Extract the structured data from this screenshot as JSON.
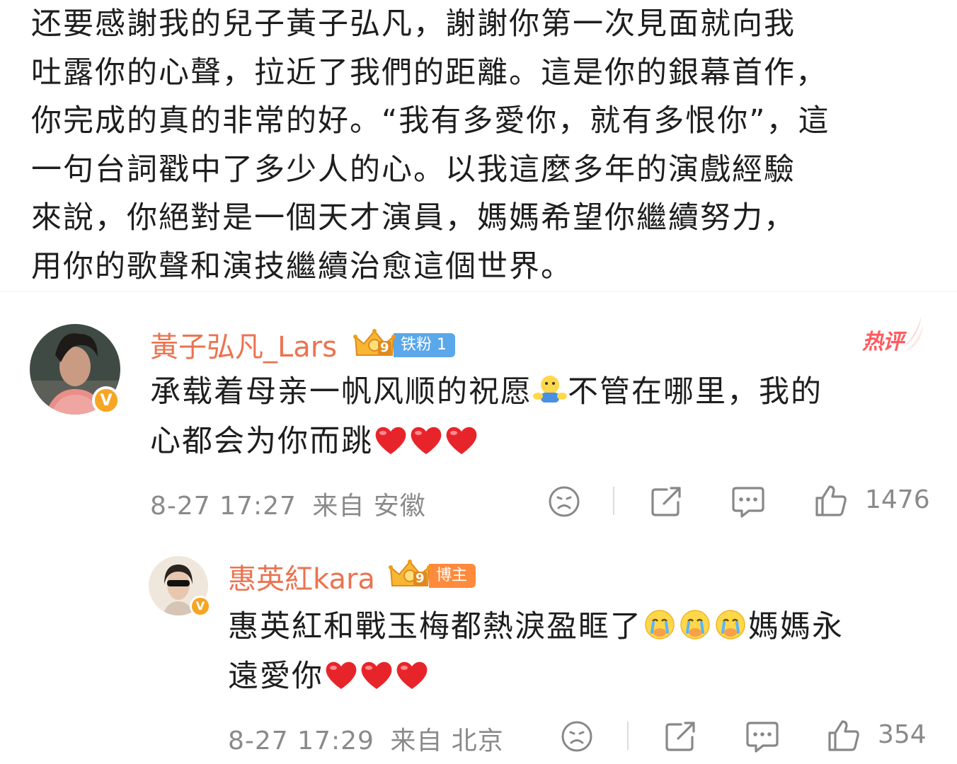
{
  "post": {
    "lines": [
      "还要感謝我的兒子黃子弘凡，謝謝你第一次見面就向我",
      "吐露你的心聲，拉近了我們的距離。這是你的銀幕首作，",
      "你完成的真的非常的好。“我有多愛你，就有多恨你”，這",
      "一句台詞戳中了多少人的心。以我這麼多年的演戲經驗",
      "來說，你絕對是一個天才演員，媽媽希望你繼續努力，",
      "用你的歌聲和演技繼續治愈這個世界。"
    ]
  },
  "comments": [
    {
      "username": "黃子弘凡_Lars",
      "badge_level": "9",
      "badge_label": "铁粉 1",
      "hot_label": "热评",
      "text_lines": [
        "承载着母亲一帆风顺的祝愿",
        "不管在哪里，我的",
        "心都会为你而跳"
      ],
      "time": "8-27 17:27",
      "source": "来自 安徽",
      "like_count": "1476"
    },
    {
      "username": "惠英紅kara",
      "badge_level": "9",
      "badge_label": "博主",
      "text_lines": [
        "惠英紅和戰玉梅都熱淚盈眶了",
        "媽媽永",
        "遠愛你"
      ],
      "time": "8-27 17:29",
      "source": "来自 北京",
      "like_count": "354"
    }
  ],
  "icons": {
    "sad": "sad-face-icon",
    "share": "share-icon",
    "comment": "comment-icon",
    "like": "thumbs-up-icon",
    "verified": "verified-v-icon",
    "crown": "crown-badge-icon",
    "heart": "red-heart-emoji",
    "hug": "hug-emoji",
    "cry": "crying-emoji"
  },
  "colors": {
    "username": "#eb7350",
    "badge_blue": "#5aa7ea",
    "badge_orange": "#ff8a3c",
    "hot": "#ff5a5f",
    "meta_gray": "#8a8a8a"
  }
}
